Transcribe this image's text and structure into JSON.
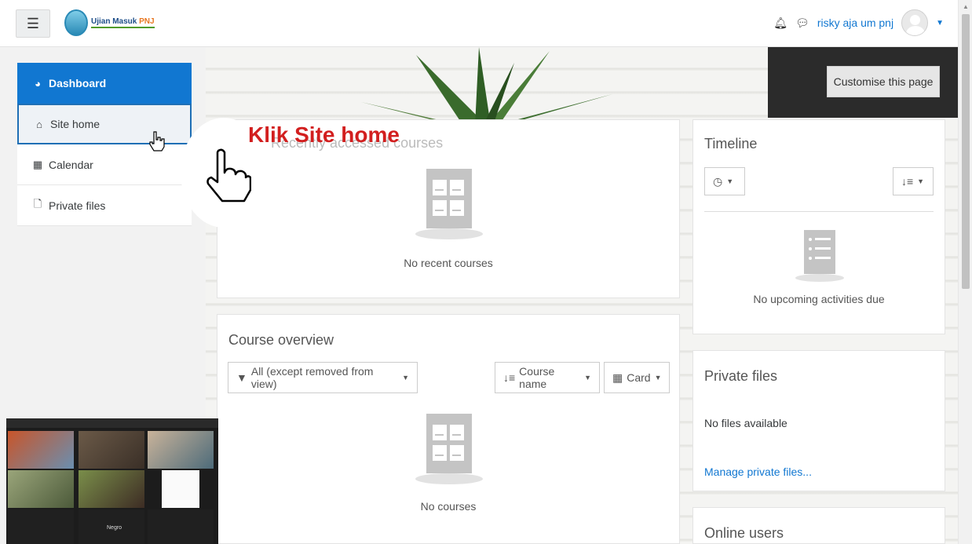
{
  "navbar": {
    "logo_text_main": "Ujian Masuk",
    "logo_text_accent": "PNJ",
    "username": "risky aja um pnj"
  },
  "sidebar": {
    "items": [
      {
        "label": "Dashboard",
        "icon": "dashboard-icon",
        "active": true
      },
      {
        "label": "Site home",
        "icon": "home-icon"
      },
      {
        "label": "Calendar",
        "icon": "calendar-icon"
      },
      {
        "label": "Private files",
        "icon": "file-icon"
      }
    ]
  },
  "header": {
    "customise_label": "Customise this page"
  },
  "annotation": {
    "instruction": "Klik Site home"
  },
  "recent_courses": {
    "title": "Recently accessed courses",
    "empty_text": "No recent courses"
  },
  "course_overview": {
    "title": "Course overview",
    "filter_label": "All (except removed from view)",
    "sort_label": "Course name",
    "view_label": "Card",
    "empty_text": "No courses"
  },
  "timeline": {
    "title": "Timeline",
    "empty_text": "No upcoming activities due"
  },
  "private_files": {
    "title": "Private files",
    "empty_text": "No files available",
    "manage_link": "Manage private files..."
  },
  "online_users": {
    "title": "Online users"
  },
  "video_call": {
    "participant_name": "Negro"
  },
  "colors": {
    "primary": "#1177d1",
    "annotation": "#d21f1f"
  }
}
